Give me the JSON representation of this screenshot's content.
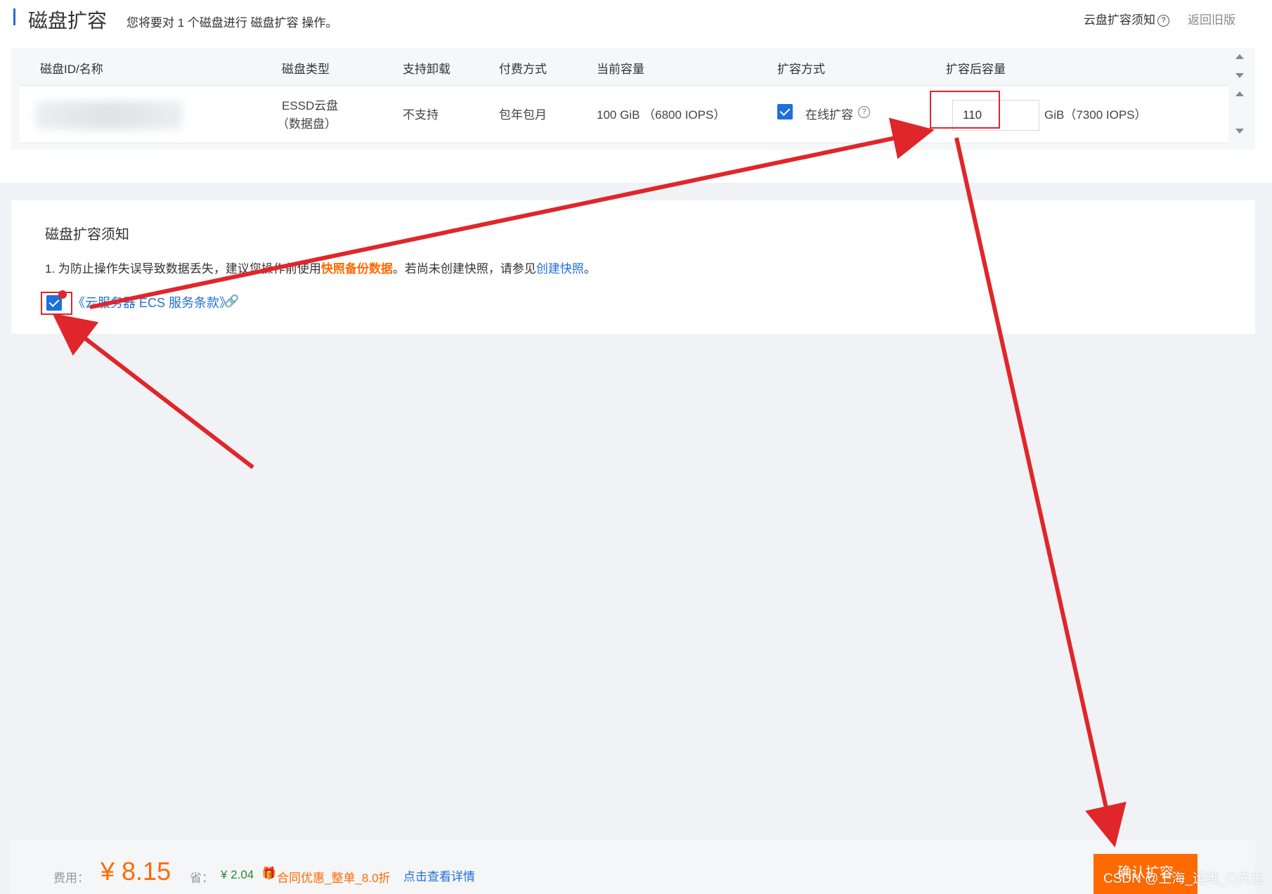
{
  "header": {
    "title": "磁盘扩容",
    "description": "您将要对 1 个磁盘进行 磁盘扩容 操作。",
    "notice_link": "云盘扩容须知",
    "back_link": "返回旧版"
  },
  "table": {
    "columns": [
      "磁盘ID/名称",
      "磁盘类型",
      "支持卸载",
      "付费方式",
      "当前容量",
      "扩容方式",
      "扩容后容量"
    ],
    "row": {
      "disk_type_line1": "ESSD云盘",
      "disk_type_line2": "（数据盘）",
      "detachable": "不支持",
      "billing": "包年包月",
      "current_capacity": "100 GiB （6800 IOPS）",
      "expand_mode_checked": true,
      "expand_mode": "在线扩容",
      "new_capacity_value": "110",
      "new_capacity_unit": "GiB（7300 IOPS）"
    }
  },
  "notice": {
    "title": "磁盘扩容须知",
    "line_prefix": "1. 为防止操作失误导致数据丢失，建议您操作前使用",
    "line_highlight": "快照备份数据",
    "line_middle": "。若尚未创建快照，请参见",
    "line_link": "创建快照",
    "line_suffix": "。",
    "terms_checked": true,
    "terms_link": "《云服务器 ECS 服务条款》"
  },
  "footer": {
    "fee_label": "费用：",
    "fee_amount": "¥ 8.15",
    "save_label": "省：",
    "save_amount": "¥ 2.04",
    "promo": "合同优惠_整单_8.0折",
    "details_link": "点击查看详情",
    "confirm_button": "确认扩容"
  },
  "watermark": "CSDN @上海_运维_Q先生",
  "colors": {
    "accent_blue": "#1e6fd9",
    "accent_orange": "#ff6a00",
    "annotation_red": "#e0262b",
    "save_green": "#2b8a2b"
  },
  "icons": [
    "question-circle-icon",
    "checkbox-checked-icon",
    "link-icon",
    "gift-icon",
    "scroll-up-icon",
    "scroll-down-icon"
  ]
}
